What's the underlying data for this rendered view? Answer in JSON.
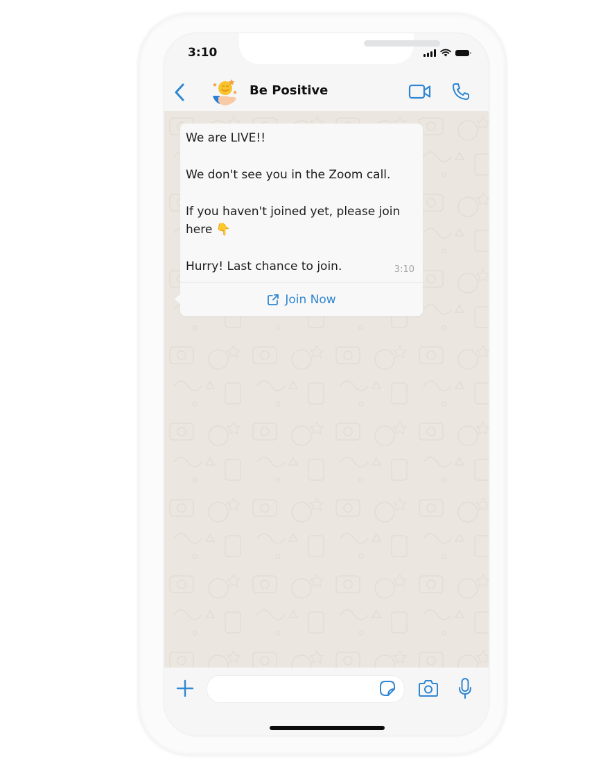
{
  "status_bar": {
    "time": "3:10",
    "icons": [
      "signal-icon",
      "wifi-icon",
      "battery-icon"
    ]
  },
  "header": {
    "contact_name": "Be Positive",
    "avatar_icon": "smiley-in-hand-avatar",
    "back_icon": "chevron-left-icon",
    "actions": [
      "video-call-icon",
      "phone-call-icon"
    ]
  },
  "message": {
    "lines": [
      "We are LIVE!!",
      "",
      "We don't see you in the Zoom call.",
      "",
      "If you haven't joined yet, please join",
      "here 👇",
      "",
      "Hurry! Last chance to join."
    ],
    "time": "3:10",
    "action_label": "Join Now",
    "action_icon": "external-link-icon"
  },
  "input_bar": {
    "text_value": "",
    "placeholder": "",
    "icons": [
      "plus-icon",
      "sticker-icon",
      "camera-icon",
      "microphone-icon"
    ]
  },
  "colors": {
    "accent": "#2f86d2",
    "chat_background": "#ebe7e0",
    "bubble": "#f8f8f8",
    "time_text": "#a4a4a4"
  }
}
